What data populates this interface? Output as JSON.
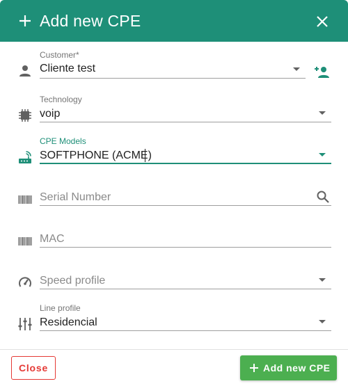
{
  "dialog": {
    "title": "Add new CPE",
    "colors": {
      "header": "#1e8f78",
      "accent": "#1e8f78",
      "add_button": "#4caf50",
      "close_button": "#e53935"
    }
  },
  "fields": {
    "customer": {
      "label": "Customer*",
      "value": "Cliente test",
      "icon": "person-icon",
      "action_icon": "add-person-icon"
    },
    "technology": {
      "label": "Technology",
      "value": "voip",
      "icon": "chip-icon"
    },
    "cpe_models": {
      "label": "CPE Models",
      "value": "SOFTPHONE (ACME)",
      "icon": "router-icon"
    },
    "serial_number": {
      "placeholder": "Serial Number",
      "icon": "barcode-icon",
      "action_icon": "search-icon"
    },
    "mac": {
      "placeholder": "MAC",
      "icon": "barcode-icon"
    },
    "speed_profile": {
      "placeholder": "Speed profile",
      "icon": "speedometer-icon"
    },
    "line_profile": {
      "label": "Line profile",
      "value": "Residencial",
      "icon": "sliders-icon"
    }
  },
  "footer": {
    "close_label": "Close",
    "add_label": "Add new CPE"
  }
}
